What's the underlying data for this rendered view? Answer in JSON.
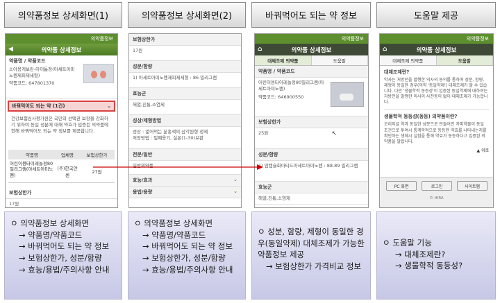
{
  "headers": [
    "의약품정보 상세화면(1)",
    "의약품정보 상세화면(2)",
    "바꿔먹어도 되는 약 정보",
    "도움말 제공"
  ],
  "screen1": {
    "brand": "의약품정보",
    "title": "의약품 상세정보",
    "drug_label": "약품명 / 약품코드",
    "drug_name": "소아용게보린-아이튬정(아세트아미노펜제피제세형)",
    "drug_code": "약품코드: 647801370",
    "swap_row": "바꿔먹어도 되는 약 (1건)",
    "notice": "건강보험심사평가원은 국민의 선택권 보장을 강화하기 위하여 동일 성분에 대해 약효가 입증된 의약품에 한해 바꿔먹어도 되는 약 정보를 제공합니다.",
    "table_headers": [
      "약품명",
      "업체명",
      "보험상한가"
    ],
    "table_row": {
      "name": "어린이용타이레놀정80밀리그램(아세트아미노펜)",
      "company": "(주)한국얀센",
      "price": "27원"
    },
    "price_label": "보험상한가",
    "price_value": "17원"
  },
  "screen2": {
    "price_label": "보험상한가",
    "price_value": "17원",
    "ingredient_label": "성분/함량",
    "ingredient_value": "1) 아세트아미노펜제피제세형 : 86 밀리그램",
    "efficacy_group_label": "효능군",
    "efficacy_group_value": "해열,진통,소염제",
    "form_label": "성상/제형방법",
    "form_value": "성상 : 엷어먹는 분홍색의 삼각원형 정제",
    "storage_value": "저장방법 : 밀폐용기, 실온(1-30)보관",
    "class_label": "전문/일반",
    "class_value": "일반의약품",
    "efficacy_label": "효능/효과",
    "usage_label": "용법/용량"
  },
  "screen3": {
    "brand": "의약품정보",
    "title": "의약품 상세정보",
    "tab_active": "대체조제 의약품",
    "tab_help": "도움말",
    "drug_label": "약품명 / 약품코드",
    "drug_name": "어린이용타이레놀정80밀리그램(아세트아미노펜)",
    "drug_code": "약품코드: 646900550",
    "price_label": "보험상한가",
    "price_value": "25원",
    "ingredient_label": "성분/함량",
    "ingredient_value": "1) 암캡슐화아티드아세트아미노펜 : 88.89 밀리그램",
    "efficacy_group_label": "효능군",
    "efficacy_group_value": "해열,진통,소염제"
  },
  "screen4": {
    "brand": "의약품정보",
    "title": "의약품 상세정보",
    "tab_one": "대체조제 의약품",
    "tab_help": "도움말",
    "q1": "대체조제란?",
    "a1": "약사는 처방전을 발행한 의사의 동의를 통하여 성분, 함량, 제형이 동일한 경우(의약 '동일약제') 대체조제가 할 수 있습니다. 다만 '생물학적 동등성'이 입증된 동일약제에 대하여는 처방전을 발행한 의사의 사전동의 없이 대체조제가 가능합니다.",
    "q2": "생물학적 동등성(동등) 의약품이란?",
    "a2": "오리지널 약과 동일한 성분으로 만들어진 카피약물이 동일 조건으로 투여시 통계학적으로 동등한 약효를 나타내는지를 확인하는 생체시 실험을 통해 약효가 동등하다고 입증된 의약품을 말합니다.",
    "top_link": "▲ 위로",
    "buttons": [
      "PC 화면",
      "로그인",
      "사이트맵"
    ],
    "footer": "© HIRA"
  },
  "descriptions": [
    {
      "title": "의약품정보 상세화면",
      "items": [
        "→ 약품명/약품코드",
        "→ 바꿔먹어도 되는 약 정보",
        "→ 보험상한가, 성분/함량",
        "→ 효능/용법/주의사항 안내"
      ]
    },
    {
      "title": "의약품정보 상세화면",
      "items": [
        "→ 약품명/약품코드",
        "→ 바꿔먹어도 되는 약 정보",
        "→ 보험상한가, 성분/함량",
        "→ 효능/용법/주의사항 안내"
      ]
    },
    {
      "title": "성분, 함량, 제형이 동일한 경우(동일약제) 대체조제가 가능한 약품정보 제공",
      "items": [
        "→ 보험상한가 가격비교 정보"
      ]
    },
    {
      "title": "도움말 기능",
      "items": [
        "→ 대체조제란?",
        "→ 생물학적 동등성?"
      ]
    }
  ],
  "colors": {
    "green": "#5d8f2e",
    "dark": "#3f4a36",
    "highlight": "#d94040",
    "arrow": "#cc0000"
  }
}
